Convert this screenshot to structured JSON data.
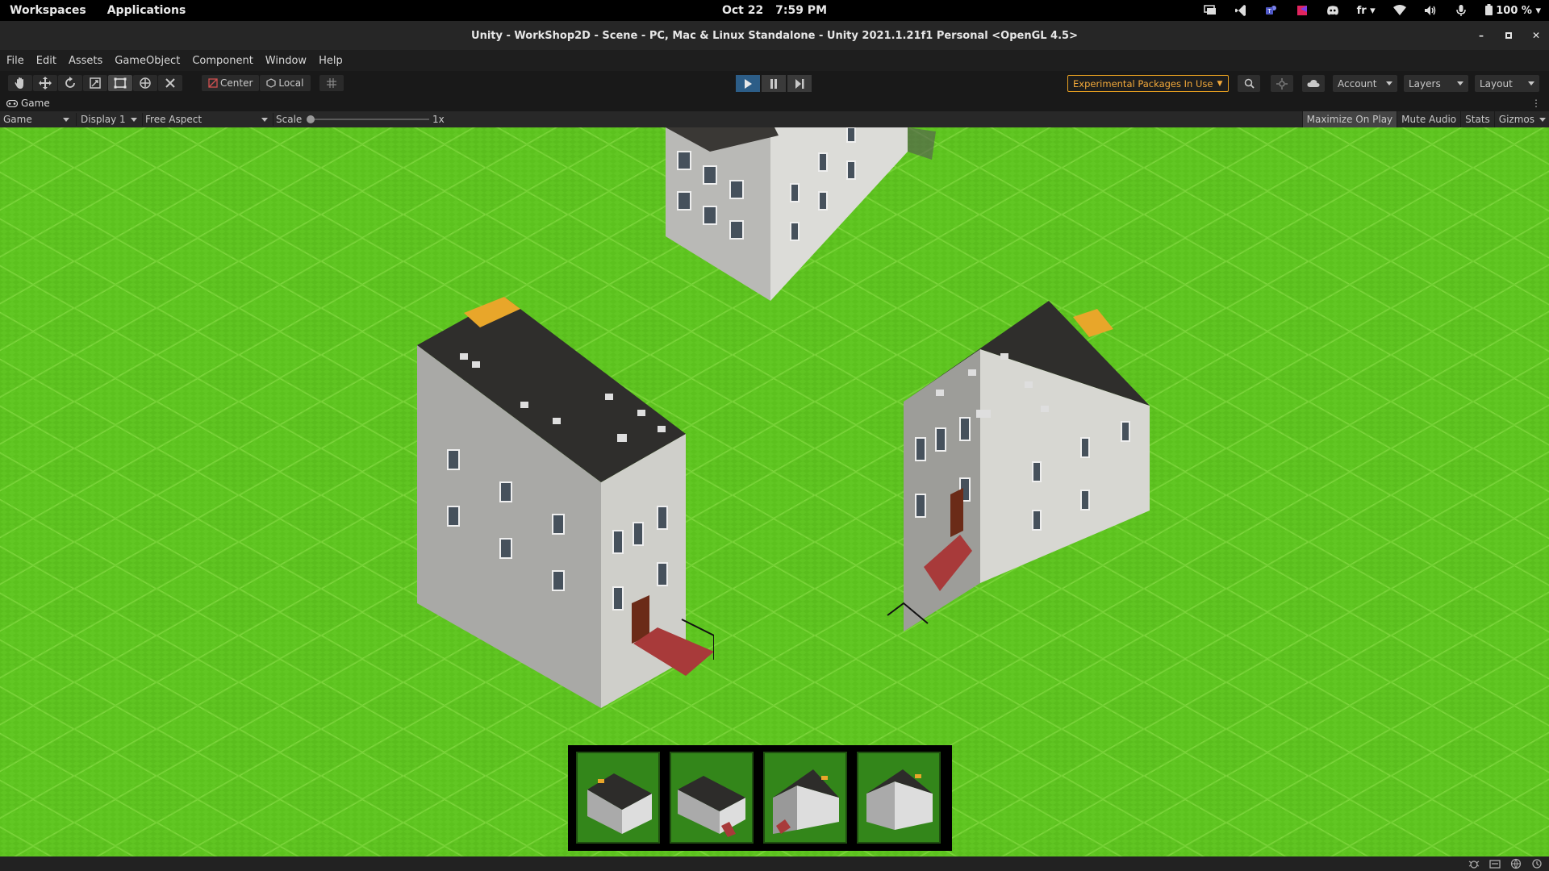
{
  "os_bar": {
    "workspaces": "Workspaces",
    "applications": "Applications",
    "date": "Oct 22",
    "time": "7:59 PM",
    "language": "fr",
    "battery": "100 %"
  },
  "window": {
    "title": "Unity - WorkShop2D - Scene - PC, Mac & Linux Standalone - Unity 2021.1.21f1 Personal <OpenGL 4.5>"
  },
  "menu": [
    "File",
    "Edit",
    "Assets",
    "GameObject",
    "Component",
    "Window",
    "Help"
  ],
  "toolbar": {
    "pivot_mode": "Center",
    "pivot_rotation": "Local",
    "experimental_packages": "Experimental Packages In Use",
    "account": "Account",
    "layers": "Layers",
    "layout": "Layout",
    "accent_color": "#2c5d87",
    "warning_color": "#f3a93a"
  },
  "game_tab": {
    "label": "Game"
  },
  "game_view_bar": {
    "view_mode": "Game",
    "display": "Display 1",
    "aspect": "Free Aspect",
    "scale_label": "Scale",
    "scale_value": "1x",
    "maximize_on_play": "Maximize On Play",
    "mute_audio": "Mute Audio",
    "stats": "Stats",
    "gizmos": "Gizmos"
  },
  "scene": {
    "ground_color": "#5cc21e",
    "buildings": [
      "building-top",
      "building-left",
      "building-right"
    ],
    "selection_slots": 4
  }
}
